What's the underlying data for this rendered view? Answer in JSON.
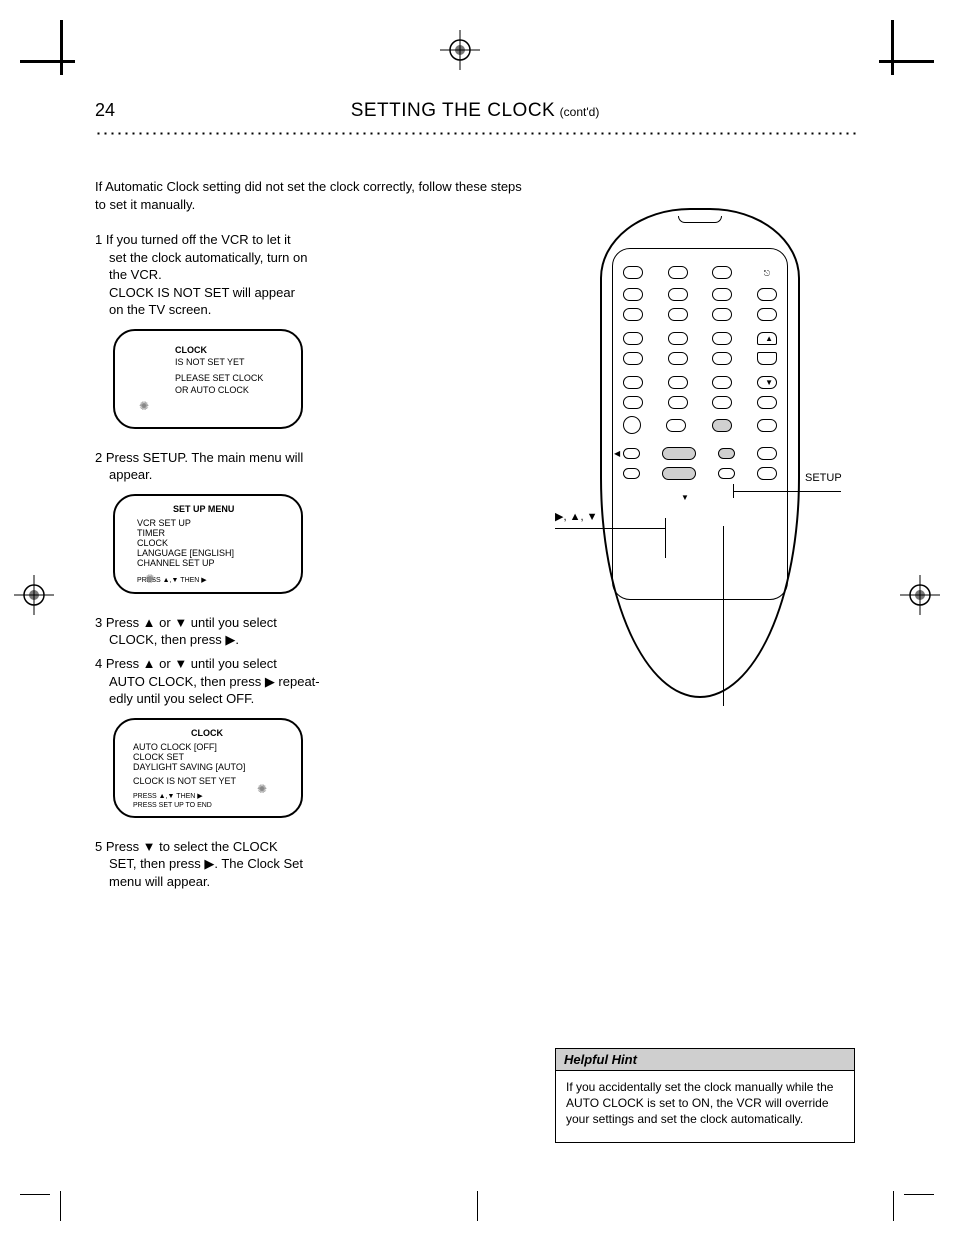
{
  "page_number": "24",
  "header_title": "SETTING THE CLOCK",
  "header_sub": "(cont'd)",
  "intro": "If Automatic Clock setting did not set the clock correctly, follow these steps to set it manually.",
  "steps": {
    "s1a": "1 If you turned off the VCR to let it",
    "s1b": "  set the clock automatically, turn on",
    "s1c": "  the VCR.",
    "s1d": "  CLOCK IS NOT SET will appear",
    "s1e": "  on the TV screen.",
    "s2a": "2 Press SETUP. The main menu will",
    "s2b": "  appear.",
    "s3a": "3 Press ▲ or ▼ until you select",
    "s3b": "  CLOCK, then press ▶.",
    "s4a": "4 Press ▲ or ▼ until you select",
    "s4b": "  AUTO CLOCK, then press ▶ repeat-",
    "s4c": "  edly until you select OFF.",
    "s5a": "5 Press ▼ to select the CLOCK",
    "s5b": "  SET, then press ▶. The Clock Set",
    "s5c": "  menu will appear."
  },
  "screen1": {
    "l1": "CLOCK",
    "l2": "IS NOT SET YET",
    "l3": "PLEASE SET CLOCK",
    "l4": "OR AUTO CLOCK"
  },
  "screen2": {
    "title": "SET UP MENU",
    "o1": "VCR SET UP",
    "o2": "TIMER",
    "o3": "CLOCK",
    "o4": "LANGUAGE           [ENGLISH]",
    "o5": "CHANNEL SET UP",
    "hint": "PRESS        ▲,▼          THEN          ▶"
  },
  "screen3": {
    "title": "CLOCK",
    "o1": "AUTO CLOCK              [OFF]",
    "o2": "CLOCK SET",
    "o3": "DAYLIGHT SAVING       [AUTO]",
    "footer": "CLOCK IS NOT SET YET",
    "hint1": "PRESS       ▲,▼        THEN        ▶",
    "hint2": "PRESS SET UP         TO      END"
  },
  "remote_labels": {
    "setup": "SETUP",
    "arrows": "▶, ▲, ▼"
  },
  "tip": {
    "title": "Helpful Hint",
    "body": "If you accidentally set the clock manually while the AUTO CLOCK is set to ON, the VCR will override your settings and set the clock automatically."
  }
}
